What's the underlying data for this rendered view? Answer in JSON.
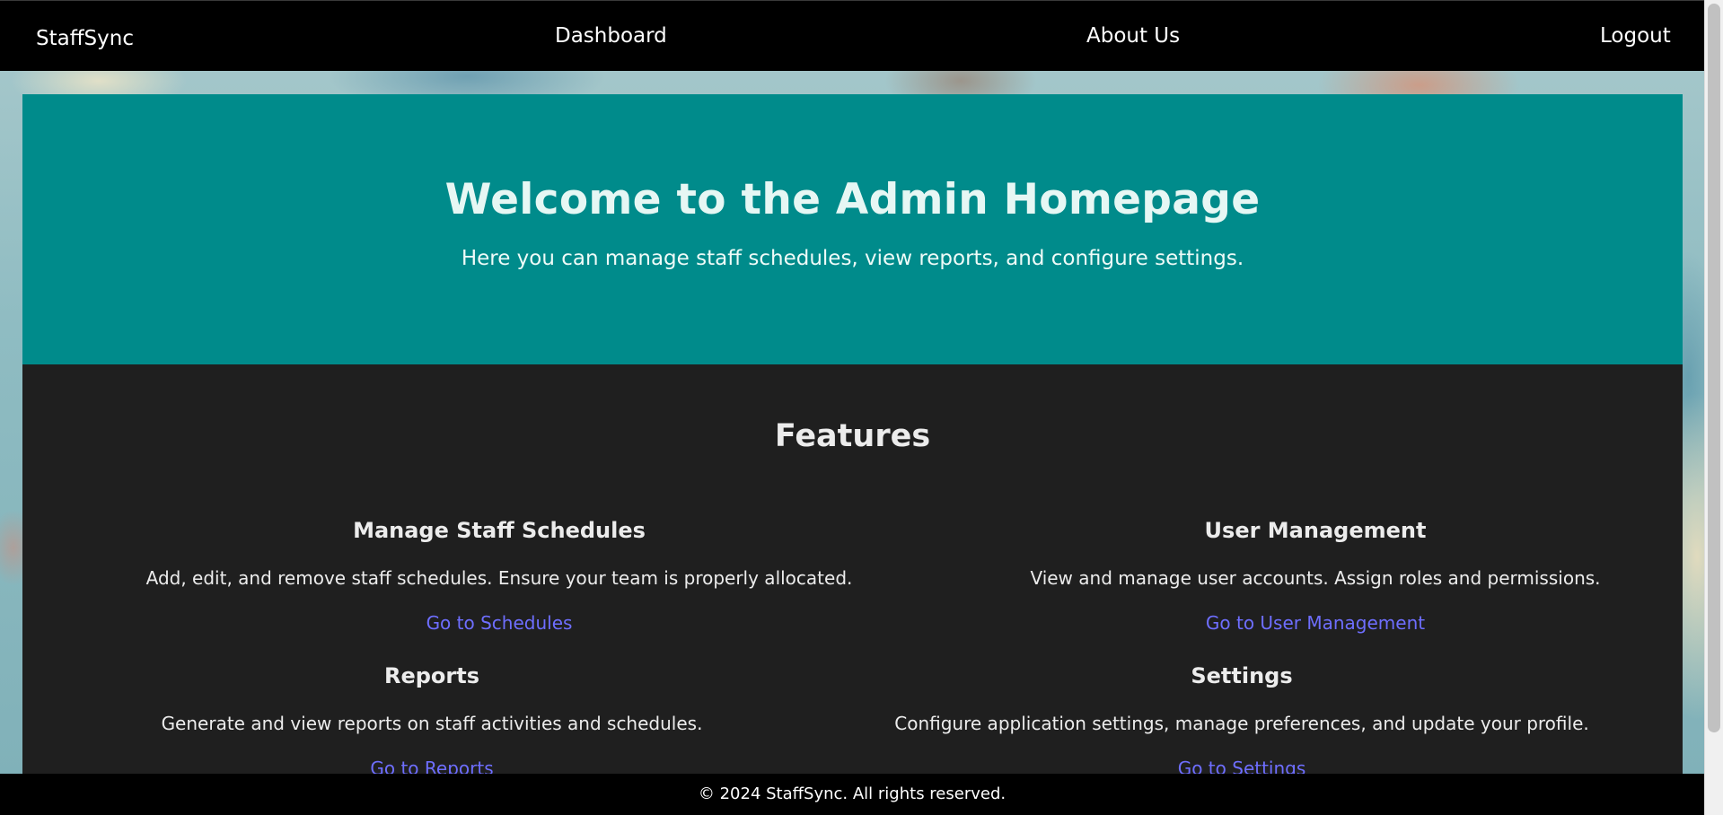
{
  "nav": {
    "brand": "StaffSync",
    "links": [
      {
        "label": "Dashboard"
      },
      {
        "label": "About Us"
      },
      {
        "label": "Logout"
      }
    ]
  },
  "hero": {
    "title": "Welcome to the Admin Homepage",
    "subtitle": "Here you can manage staff schedules, view reports, and configure settings."
  },
  "features": {
    "heading": "Features",
    "items": [
      {
        "title": "Manage Staff Schedules",
        "description": "Add, edit, and remove staff schedules. Ensure your team is properly allocated.",
        "link": "Go to Schedules"
      },
      {
        "title": "User Management",
        "description": "View and manage user accounts. Assign roles and permissions.",
        "link": "Go to User Management"
      },
      {
        "title": "Reports",
        "description": "Generate and view reports on staff activities and schedules.",
        "link": "Go to Reports"
      },
      {
        "title": "Settings",
        "description": "Configure application settings, manage preferences, and update your profile.",
        "link": "Go to Settings"
      }
    ]
  },
  "footer": {
    "text": "© 2024 StaffSync. All rights reserved."
  },
  "colors": {
    "navbar": "#000000",
    "hero": "#008b8b",
    "features_bg": "#1f1f1f",
    "link": "#6e6eff"
  }
}
